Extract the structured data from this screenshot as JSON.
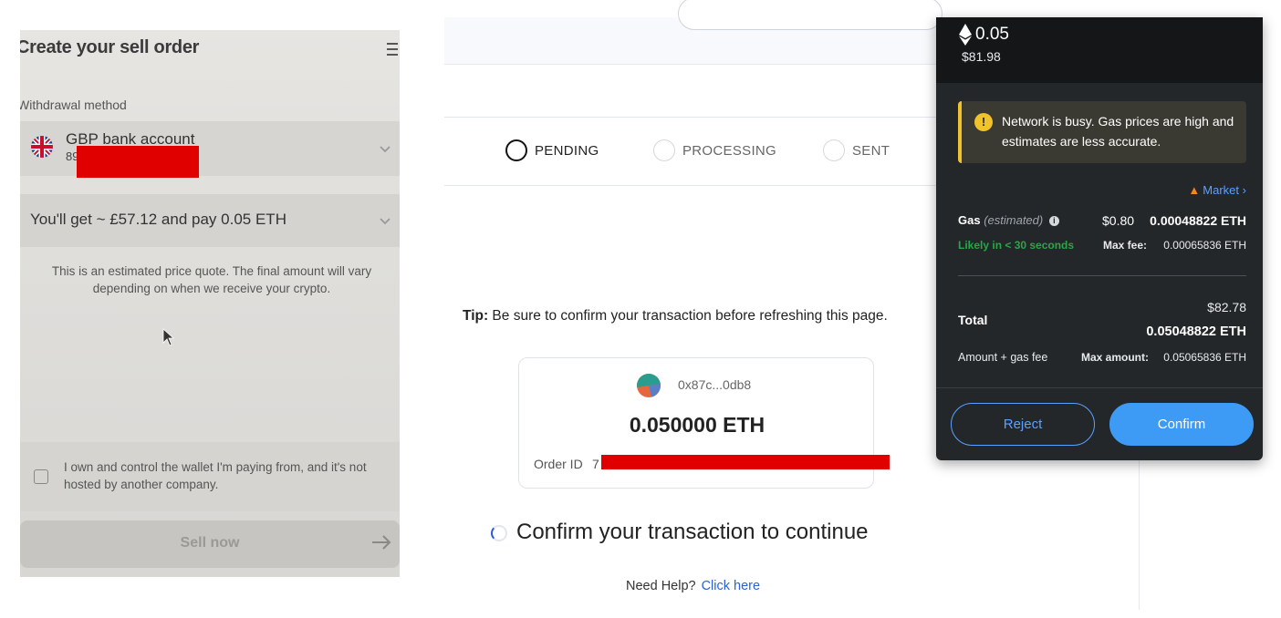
{
  "sell_order": {
    "title": "Create your sell order",
    "withdrawal_label": "Withdrawal method",
    "bank_account": "GBP bank account",
    "bank_account_number": "89",
    "pay_summary": "You'll get ~ £57.12 and pay 0.05 ETH",
    "quote_note": "This is an estimated price quote. The final amount will vary depending on when we receive your crypto.",
    "wallet_ownership": "I own and control the wallet I'm paying from, and it's not hosted by another company.",
    "wallet_ownership_checked": false,
    "sell_button": "Sell now",
    "icons": {
      "menu": "hamburger-icon",
      "flag": "uk-flag-icon",
      "chevron": "chevron-down-icon",
      "arrow": "arrow-right-icon",
      "cursor": "mouse-cursor-icon"
    }
  },
  "web_page": {
    "steps": [
      {
        "label": "PENDING",
        "active": true
      },
      {
        "label": "PROCESSING",
        "active": false
      },
      {
        "label": "SENT",
        "active": false
      }
    ],
    "tip_bold": "Tip:",
    "tip_text": " Be sure to confirm your transaction before refreshing this page.",
    "wallet_address": "0x87c...0db8",
    "amount": "0.050000 ETH",
    "order_id_label": "Order ID",
    "order_id_value": "7",
    "status_text": "Confirm your transaction to continue",
    "help_text": "Need Help?",
    "help_link": "Click here",
    "link_color": "#2a62d4"
  },
  "metamask": {
    "eth_amount": "0.05",
    "usd_amount": "$81.98",
    "warning": "Network is busy. Gas prices are high and estimates are less accurate.",
    "warning_icon": "!",
    "market_label": "Market",
    "gas_label": "Gas",
    "gas_estimated": "(estimated)",
    "gas_usd": "$0.80",
    "gas_eth": "0.00048822 ETH",
    "likely_time": "Likely in < 30 seconds",
    "max_fee_label": "Max fee:",
    "max_fee_value": "0.00065836 ETH",
    "total_label": "Total",
    "total_usd": "$82.78",
    "total_eth": "0.05048822 ETH",
    "amount_gas_label": "Amount + gas fee",
    "max_amount_label": "Max amount:",
    "max_amount_value": "0.05065836 ETH",
    "reject_button": "Reject",
    "confirm_button": "Confirm",
    "accent_color": "#3e9bf5",
    "warning_color": "#f0c22c",
    "success_color": "#28a745"
  }
}
